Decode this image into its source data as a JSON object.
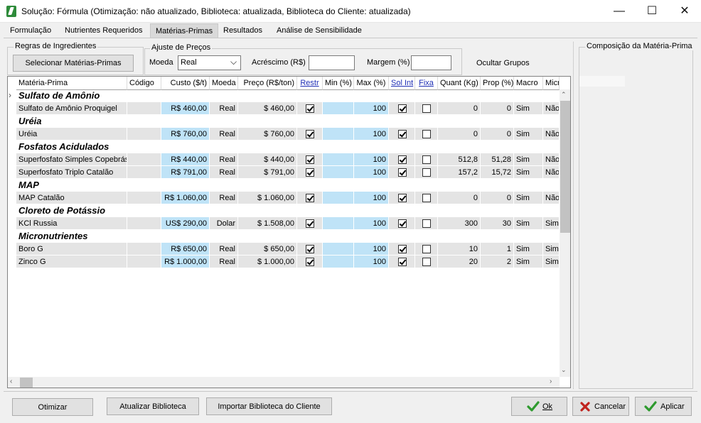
{
  "window": {
    "title": "Solução: Fórmula (Otimização: não atualizado, Biblioteca: atualizada, Biblioteca do Cliente: atualizada)",
    "minimize": "—",
    "maximize": "☐",
    "close": "✕"
  },
  "tabs": [
    {
      "label": "Formulação"
    },
    {
      "label": "Nutrientes Requeridos"
    },
    {
      "label": "Matérias-Primas"
    },
    {
      "label": "Resultados"
    },
    {
      "label": "Análise de Sensibilidade"
    }
  ],
  "ingredient_rules": {
    "legend": "Regras de Ingredientes",
    "select_button": "Selecionar Matérias-Primas"
  },
  "price_adjust": {
    "legend": "Ajuste de Preços",
    "currency_label": "Moeda",
    "currency_value": "Real",
    "surcharge_label": "Acréscimo (R$)",
    "surcharge_value": "",
    "margin_label": "Margem (%)",
    "margin_value": ""
  },
  "hide_groups": "Ocultar Grupos",
  "composition": {
    "legend": "Composição da Matéria-Prima"
  },
  "grid": {
    "columns": [
      "Matéria-Prima",
      "Código",
      "Custo ($/t)",
      "Moeda",
      "Preço (R$/ton)",
      "Restr",
      "Min (%)",
      "Max (%)",
      "Sol Int",
      "Fixa",
      "Quant (Kg)",
      "Prop (%)",
      "Macro",
      "Micr"
    ],
    "groups": [
      {
        "name": "Sulfato de Amônio",
        "rows": [
          {
            "name": "Sulfato de Amônio Proquigel",
            "code": "",
            "cost": "R$ 460,00",
            "currency": "Real",
            "price": "$ 460,00",
            "restr": true,
            "min": "",
            "max": "100",
            "solint": true,
            "fixa": false,
            "quant": "0",
            "prop": "0",
            "macro": "Sim",
            "micro": "Não"
          }
        ]
      },
      {
        "name": "Uréia",
        "rows": [
          {
            "name": "Uréia",
            "code": "",
            "cost": "R$ 760,00",
            "currency": "Real",
            "price": "$ 760,00",
            "restr": true,
            "min": "",
            "max": "100",
            "solint": true,
            "fixa": false,
            "quant": "0",
            "prop": "0",
            "macro": "Sim",
            "micro": "Não"
          }
        ]
      },
      {
        "name": "Fosfatos Acidulados",
        "rows": [
          {
            "name": "Superfosfato Simples Copebrás",
            "code": "",
            "cost": "R$ 440,00",
            "currency": "Real",
            "price": "$ 440,00",
            "restr": true,
            "min": "",
            "max": "100",
            "solint": true,
            "fixa": false,
            "quant": "512,8",
            "prop": "51,28",
            "macro": "Sim",
            "micro": "Não"
          },
          {
            "name": "Superfosfato Triplo Catalão",
            "code": "",
            "cost": "R$ 791,00",
            "currency": "Real",
            "price": "$ 791,00",
            "restr": true,
            "min": "",
            "max": "100",
            "solint": true,
            "fixa": false,
            "quant": "157,2",
            "prop": "15,72",
            "macro": "Sim",
            "micro": "Não"
          }
        ]
      },
      {
        "name": "MAP",
        "rows": [
          {
            "name": "MAP Catalão",
            "code": "",
            "cost": "R$ 1.060,00",
            "currency": "Real",
            "price": "$ 1.060,00",
            "restr": true,
            "min": "",
            "max": "100",
            "solint": true,
            "fixa": false,
            "quant": "0",
            "prop": "0",
            "macro": "Sim",
            "micro": "Não"
          }
        ]
      },
      {
        "name": "Cloreto de Potássio",
        "rows": [
          {
            "name": "KCl Russia",
            "code": "",
            "cost": "US$ 290,00",
            "currency": "Dolar",
            "price": "$ 1.508,00",
            "restr": true,
            "min": "",
            "max": "100",
            "solint": true,
            "fixa": false,
            "quant": "300",
            "prop": "30",
            "macro": "Sim",
            "micro": "Sim"
          }
        ]
      },
      {
        "name": "Micronutrientes",
        "rows": [
          {
            "name": "Boro G",
            "code": "",
            "cost": "R$ 650,00",
            "currency": "Real",
            "price": "$ 650,00",
            "restr": true,
            "min": "",
            "max": "100",
            "solint": true,
            "fixa": false,
            "quant": "10",
            "prop": "1",
            "macro": "Sim",
            "micro": "Sim"
          },
          {
            "name": "Zinco G",
            "code": "",
            "cost": "R$ 1.000,00",
            "currency": "Real",
            "price": "$ 1.000,00",
            "restr": true,
            "min": "",
            "max": "100",
            "solint": true,
            "fixa": false,
            "quant": "20",
            "prop": "2",
            "macro": "Sim",
            "micro": "Sim"
          }
        ]
      }
    ]
  },
  "buttons": {
    "optimize": "Otimizar",
    "update_library": "Atualizar Biblioteca",
    "import_library": "Importar Biblioteca do Cliente",
    "ok": "Ok",
    "cancel": "Cancelar",
    "apply": "Aplicar"
  },
  "icons": {
    "ok": "check-icon",
    "cancel": "x-icon",
    "apply": "check-icon"
  },
  "colors": {
    "cell_blue": "#bfe3f7",
    "cell_gray": "#e4e4e4",
    "link_header": "#1f2fb5",
    "check_green": "#2e9a2e",
    "cancel_red": "#c0231e"
  }
}
